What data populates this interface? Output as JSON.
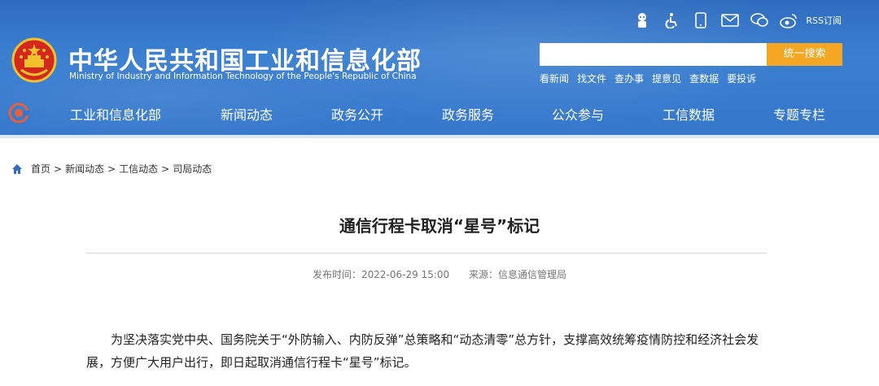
{
  "header": {
    "site_title": "中华人民共和国工业和信息化部",
    "site_subtitle": "Ministry of Industry and Information Technology of the People's Republic of China",
    "rss_label": "RSS订阅",
    "search_placeholder": "",
    "search_button": "统一搜索",
    "quick_links": [
      "看新闻",
      "找文件",
      "查办事",
      "提意见",
      "查数据",
      "要投诉"
    ],
    "top_icons": [
      "robot-icon",
      "accessibility-icon",
      "mobile-icon",
      "mail-icon",
      "wechat-icon",
      "weibo-icon"
    ]
  },
  "nav": {
    "items": [
      "工业和信息化部",
      "新闻动态",
      "政务公开",
      "政务服务",
      "公众参与",
      "工信数据",
      "专题专栏"
    ]
  },
  "breadcrumb": {
    "items": [
      "首页",
      "新闻动态",
      "工信动态",
      "司局动态"
    ],
    "separator": ">"
  },
  "article": {
    "title": "通信行程卡取消“星号”标记",
    "publish_label": "发布时间：2022-06-29 15:00",
    "source_label": "来源：信息通信管理局",
    "body": "为坚决落实党中央、国务院关于“外防输入、内防反弹”总策略和“动态清零”总方针，支撑高效统筹疫情防控和经济社会发展，方便广大用户出行，即日起取消通信行程卡“星号”标记。"
  },
  "colors": {
    "header_blue": "#3577cb",
    "search_orange": "#f5a623",
    "text_dark": "#222222",
    "meta_gray": "#777777"
  }
}
